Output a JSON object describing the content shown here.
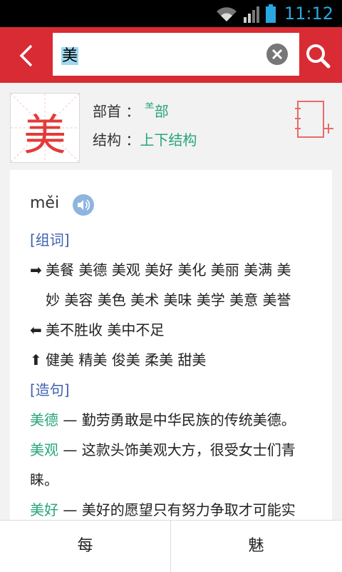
{
  "status": {
    "time": "11:12"
  },
  "search": {
    "query": "美"
  },
  "entry": {
    "character": "美",
    "radical_label": "部首 ：",
    "radical_small": "⺷",
    "radical_value": "部",
    "structure_label": "结构 ：",
    "structure_value": "上下结构"
  },
  "detail": {
    "pinyin": "měi",
    "words_header": "[组词]",
    "words_forward_line1": "美餐 美德 美观 美好 美化 美丽 美满 美",
    "words_forward_line2": "妙 美容 美色 美术 美味 美学 美意 美誉",
    "words_back": "美不胜收 美中不足",
    "words_up": "健美 精美 俊美 柔美 甜美",
    "sentences_header": "[造句]",
    "sentences": [
      {
        "word": "美德",
        "text": " — 勤劳勇敢是中华民族的传统美德。"
      },
      {
        "word": "美观",
        "text": " — 这款头饰美观大方，很受女士们青",
        "cont": "睐。"
      },
      {
        "word": "美好",
        "text": " — 美好的愿望只有努力争取才可能实"
      }
    ]
  },
  "nav": {
    "prev": "每",
    "next": "魅"
  },
  "colors": {
    "accent": "#d92b33",
    "green": "#27a57a",
    "link": "#3f5fb0"
  }
}
